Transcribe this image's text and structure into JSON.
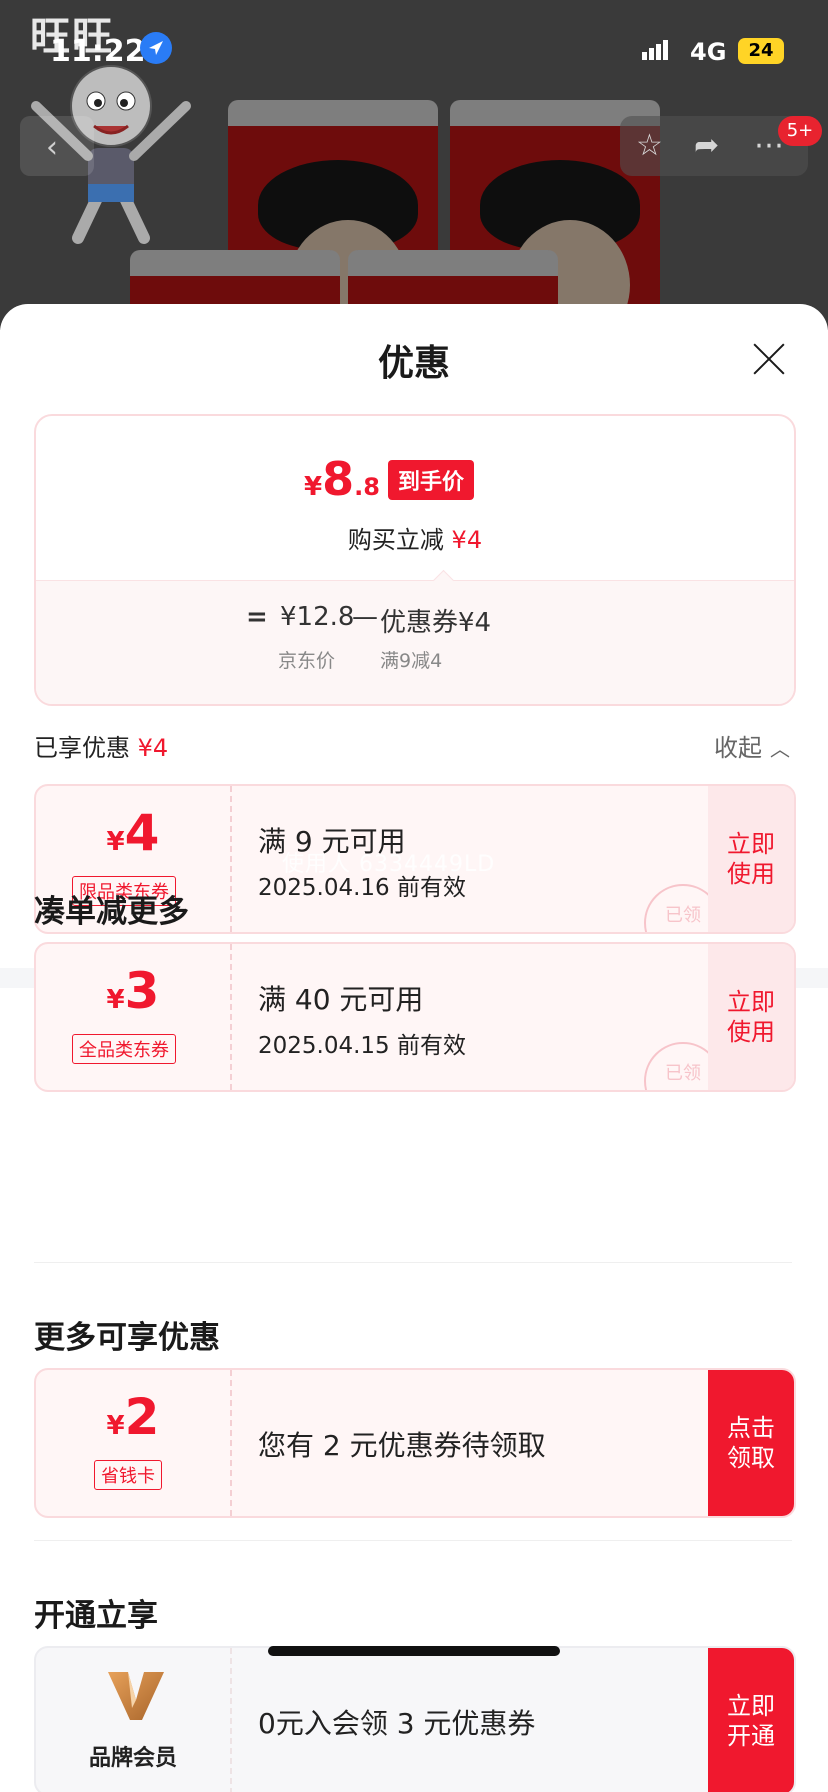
{
  "status_bar": {
    "time": "11:22",
    "network": "4G",
    "battery": "24"
  },
  "product_backdrop": {
    "brand_logo": "旺旺",
    "cart_badge": "5+"
  },
  "sheet": {
    "title": "优惠",
    "price_summary": {
      "final_yen": "¥",
      "final_int": "8",
      "final_dec": ".8",
      "final_tag": "到手价",
      "instant_label": "购买立减",
      "instant_value": "¥4",
      "equals": "=",
      "jd_price": "¥12.8",
      "minus": "—",
      "coupon_part": "优惠券¥4",
      "jd_price_label": "京东价",
      "coupon_rule": "满9减4"
    },
    "enjoyed": {
      "label": "已享优惠",
      "value": "¥4",
      "collapse_label": "收起"
    },
    "enjoyed_coupon": {
      "yen": "¥",
      "amount": "4",
      "type": "限品类东券",
      "condition": "满 9 元可用",
      "expiry": "2025.04.16 前有效",
      "action": "立即使用",
      "stamp": "已领",
      "watermark": "使用人 6334449LD"
    },
    "section_more": {
      "title": "凑单减更多",
      "coupon": {
        "yen": "¥",
        "amount": "3",
        "type": "全品类东券",
        "condition": "满 40 元可用",
        "expiry": "2025.04.15 前有效",
        "action": "立即使用",
        "stamp": "已领"
      }
    },
    "section_extra": {
      "title": "更多可享优惠",
      "card": {
        "yen": "¥",
        "amount": "2",
        "type": "省钱卡",
        "text": "您有 2 元优惠券待领取",
        "action": "点击领取"
      }
    },
    "section_member": {
      "title": "开通立享",
      "card": {
        "brand_label": "品牌会员",
        "text": "0元入会领 3 元优惠券",
        "action": "立即开通"
      }
    }
  },
  "colors": {
    "accent": "#f0182e",
    "coupon_bg": "#fff6f6",
    "border": "#fadadd"
  }
}
